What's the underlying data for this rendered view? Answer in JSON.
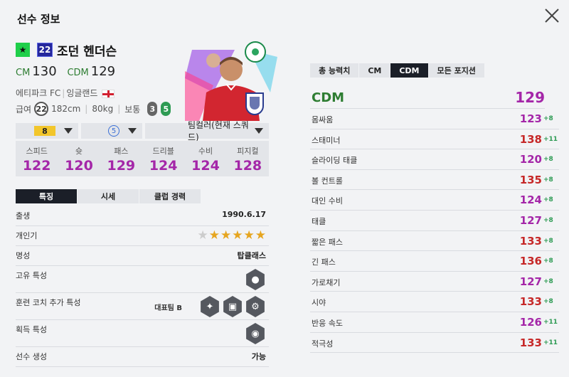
{
  "window": {
    "title": "선수 정보"
  },
  "player": {
    "grade": "★",
    "number": "22",
    "name": "조던 헨더슨",
    "ovr": [
      {
        "pos": "CM",
        "val": "130"
      },
      {
        "pos": "CDM",
        "val": "129"
      }
    ],
    "club": "에티파크 FC",
    "nation": "잉글랜드",
    "pay_label": "급여",
    "pay": "22",
    "height": "182cm",
    "weight": "80kg",
    "body": "보통",
    "weak_foot": "3",
    "strong_foot": "5"
  },
  "selectors": {
    "level": "8",
    "upgrade": "5",
    "team_color": "팀컬러(현재 스쿼드)"
  },
  "stats": [
    {
      "label": "스피드",
      "value": "122"
    },
    {
      "label": "슛",
      "value": "120"
    },
    {
      "label": "패스",
      "value": "129"
    },
    {
      "label": "드리블",
      "value": "124"
    },
    {
      "label": "수비",
      "value": "124"
    },
    {
      "label": "피지컬",
      "value": "128"
    }
  ],
  "detail_tabs": [
    "특징",
    "시세",
    "클럽 경력"
  ],
  "details": {
    "birth_label": "출생",
    "birth": "1990.6.17",
    "popularity_label": "개인기",
    "popularity_stars": 5,
    "fame_label": "명성",
    "fame": "탑클래스",
    "trait_label": "고유 특성",
    "coach_label": "훈련 코치 추가 특성",
    "coach_value": "대표팀 B",
    "acquired_label": "획득 특성",
    "create_label": "선수 생성",
    "create_value": "가능"
  },
  "position_tabs": [
    "총 능력치",
    "CM",
    "CDM",
    "모든 포지션"
  ],
  "position": {
    "name": "CDM",
    "value": "129"
  },
  "attributes": [
    {
      "label": "몸싸움",
      "value": "123",
      "bonus": "+8",
      "color": "#a426a8"
    },
    {
      "label": "스태미너",
      "value": "138",
      "bonus": "+11",
      "color": "#c62828"
    },
    {
      "label": "슬라이딩 태클",
      "value": "120",
      "bonus": "+8",
      "color": "#a426a8"
    },
    {
      "label": "볼 컨트롤",
      "value": "135",
      "bonus": "+8",
      "color": "#c62828"
    },
    {
      "label": "대인 수비",
      "value": "124",
      "bonus": "+8",
      "color": "#a426a8"
    },
    {
      "label": "태클",
      "value": "127",
      "bonus": "+8",
      "color": "#a426a8"
    },
    {
      "label": "짧은 패스",
      "value": "133",
      "bonus": "+8",
      "color": "#c62828"
    },
    {
      "label": "긴 패스",
      "value": "136",
      "bonus": "+8",
      "color": "#c62828"
    },
    {
      "label": "가로채기",
      "value": "127",
      "bonus": "+8",
      "color": "#a426a8"
    },
    {
      "label": "시야",
      "value": "133",
      "bonus": "+8",
      "color": "#c62828"
    },
    {
      "label": "반응 속도",
      "value": "126",
      "bonus": "+11",
      "color": "#a426a8"
    },
    {
      "label": "적극성",
      "value": "133",
      "bonus": "+11",
      "color": "#c62828"
    }
  ]
}
